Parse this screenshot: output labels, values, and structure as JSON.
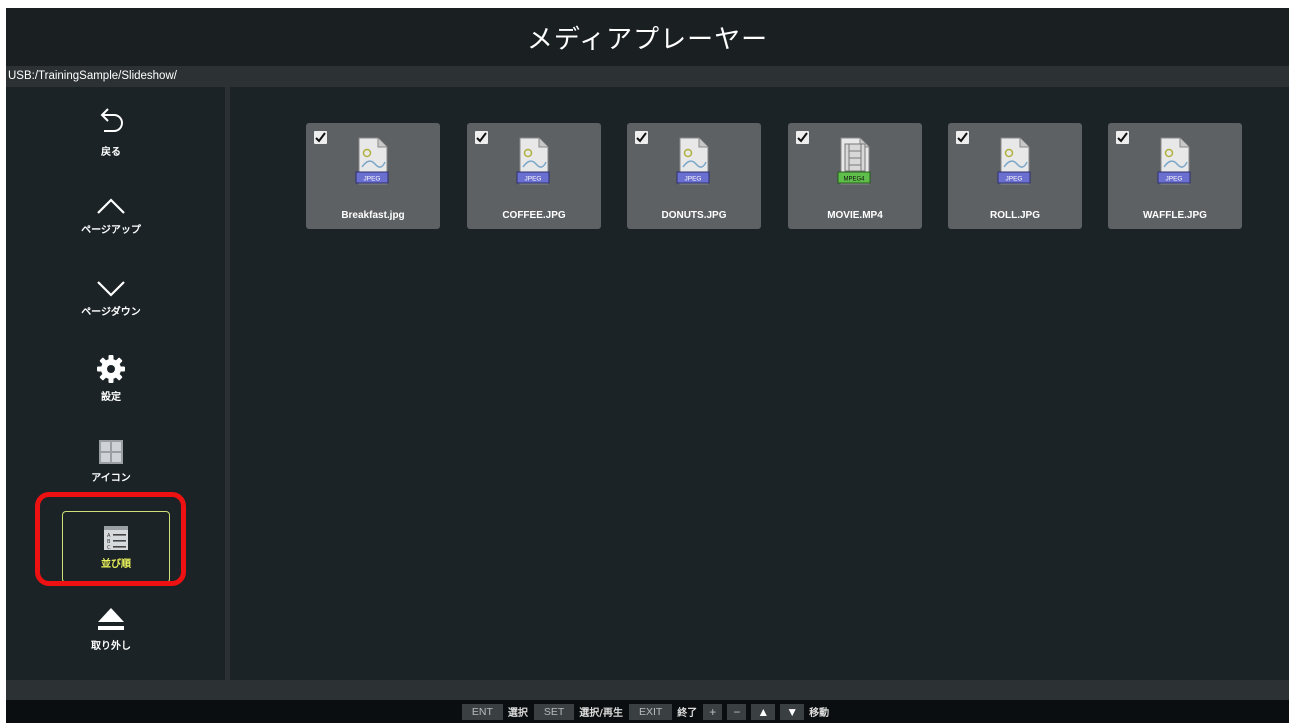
{
  "app": {
    "title": "メディアプレーヤー",
    "path": "USB:/TrainingSample/Slideshow/"
  },
  "sidebar": {
    "items": [
      {
        "label": "戻る",
        "icon": "back-arrow-icon"
      },
      {
        "label": "ページアップ",
        "icon": "chevron-up-icon"
      },
      {
        "label": "ページダウン",
        "icon": "chevron-down-icon"
      },
      {
        "label": "設定",
        "icon": "gear-icon"
      },
      {
        "label": "アイコン",
        "icon": "grid-view-icon"
      },
      {
        "label": "並び順",
        "icon": "sort-list-icon",
        "selected": true
      },
      {
        "label": "取り外し",
        "icon": "eject-icon"
      }
    ]
  },
  "files": [
    {
      "name": "Breakfast.jpg",
      "type": "JPEG",
      "checked": true
    },
    {
      "name": "COFFEE.JPG",
      "type": "JPEG",
      "checked": true
    },
    {
      "name": "DONUTS.JPG",
      "type": "JPEG",
      "checked": true
    },
    {
      "name": "MOVIE.MP4",
      "type": "MPEG4",
      "checked": true
    },
    {
      "name": "ROLL.JPG",
      "type": "JPEG",
      "checked": true
    },
    {
      "name": "WAFFLE.JPG",
      "type": "JPEG",
      "checked": true
    }
  ],
  "help_bar": {
    "ent_key": "ENT",
    "ent_desc": "選択",
    "set_key": "SET",
    "set_desc": "選択/再生",
    "exit_key": "EXIT",
    "exit_desc": "終了",
    "plus_key": "+",
    "minus_key": "−",
    "up_key": "▲",
    "down_key": "▼",
    "move_desc": "移動"
  },
  "colors": {
    "background": "#1b2326",
    "tile": "#5e6164",
    "selected_label": "#e8f05c",
    "highlight_ring": "#ee1111",
    "jpeg_badge": "#6a6fd0",
    "mpeg4_badge": "#5fbf4a"
  }
}
